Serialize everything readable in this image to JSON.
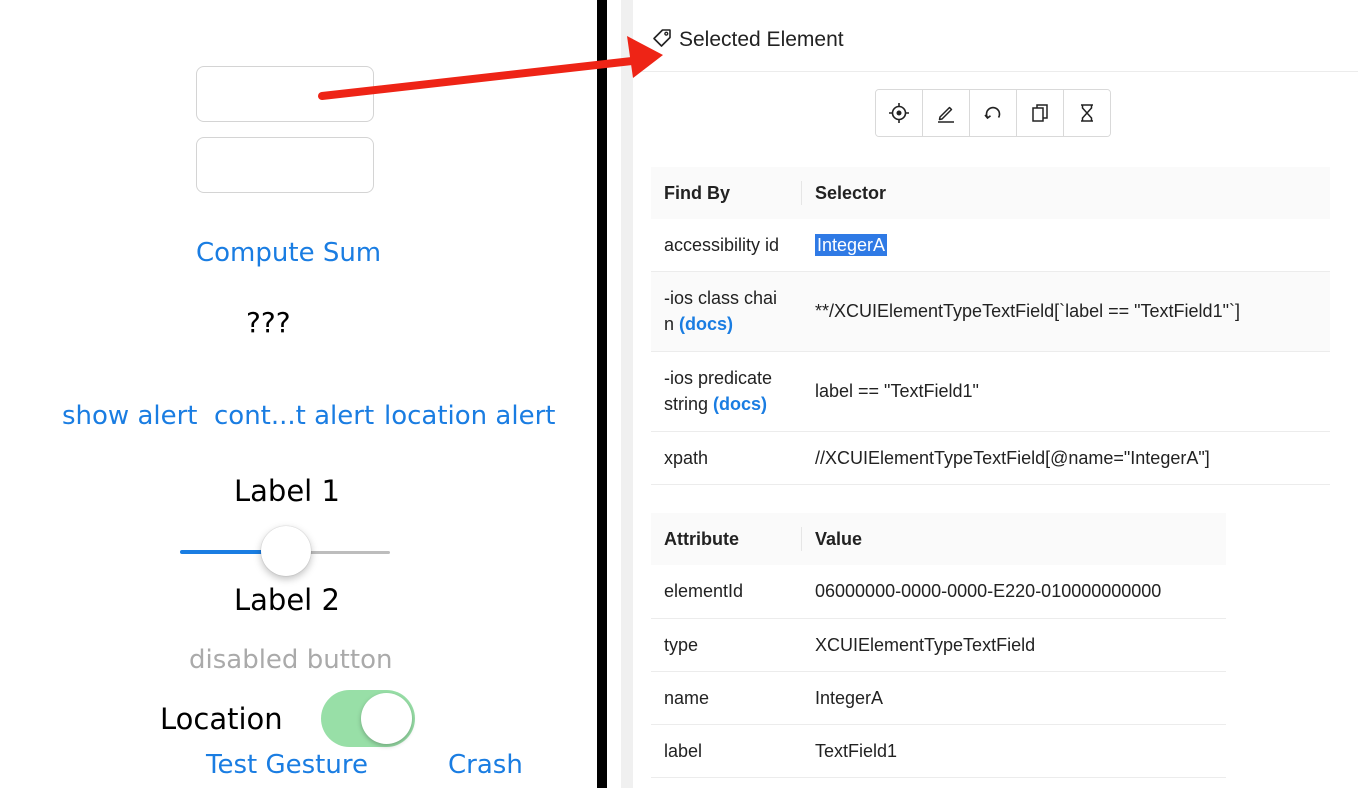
{
  "app": {
    "compute_sum": "Compute Sum",
    "result": "???",
    "show_alert": "show alert",
    "contact_alert": "cont...t alert",
    "location_alert": "location alert",
    "label1": "Label 1",
    "label2": "Label 2",
    "disabled_button": "disabled button",
    "location_label": "Location",
    "test_gesture": "Test Gesture",
    "crash": "Crash",
    "slider_value": 0.5,
    "location_toggle_on": true
  },
  "inspector": {
    "title": "Selected Element",
    "toolbar": [
      "tap-icon",
      "send-keys-icon",
      "clear-icon",
      "copy-attributes-icon",
      "timing-icon"
    ],
    "find_table": {
      "headers": [
        "Find By",
        "Selector"
      ],
      "rows": [
        {
          "by": "accessibility id",
          "docs": "",
          "selector": "IntegerA"
        },
        {
          "by": "-ios class chai n",
          "docs": "(docs)",
          "selector": "**/XCUIElementTypeTextField[`label == \"TextField1\"`]"
        },
        {
          "by": "-ios predicate string",
          "docs": "(docs)",
          "selector": "label == \"TextField1\""
        },
        {
          "by": "xpath",
          "docs": "",
          "selector": "//XCUIElementTypeTextField[@name=\"IntegerA\"]"
        }
      ]
    },
    "attr_table": {
      "headers": [
        "Attribute",
        "Value"
      ],
      "rows": [
        {
          "attr": "elementId",
          "value": "06000000-0000-0000-E220-010000000000"
        },
        {
          "attr": "type",
          "value": "XCUIElementTypeTextField"
        },
        {
          "attr": "name",
          "value": "IntegerA"
        },
        {
          "attr": "label",
          "value": "TextField1"
        }
      ]
    }
  },
  "colors": {
    "ios_blue": "#1a7de2",
    "toggle_green": "#98dfa7",
    "annotation_arrow": "#ee2416",
    "highlight": "#2f7ae5"
  }
}
